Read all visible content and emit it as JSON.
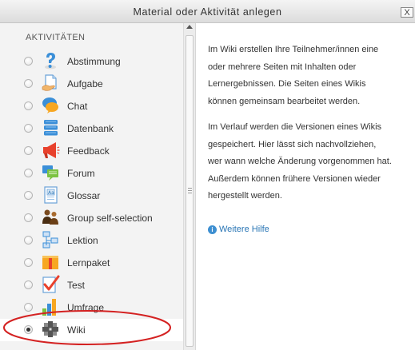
{
  "dialog": {
    "title": "Material oder Aktivität anlegen",
    "close_label": "X"
  },
  "sidebar": {
    "heading": "AKTIVITÄTEN",
    "items": [
      {
        "label": "Abstimmung",
        "icon": "question-icon",
        "checked": false
      },
      {
        "label": "Aufgabe",
        "icon": "assignment-icon",
        "checked": false
      },
      {
        "label": "Chat",
        "icon": "chat-icon",
        "checked": false
      },
      {
        "label": "Datenbank",
        "icon": "database-icon",
        "checked": false
      },
      {
        "label": "Feedback",
        "icon": "megaphone-icon",
        "checked": false
      },
      {
        "label": "Forum",
        "icon": "forum-icon",
        "checked": false
      },
      {
        "label": "Glossar",
        "icon": "glossary-icon",
        "checked": false
      },
      {
        "label": "Group self-selection",
        "icon": "group-icon",
        "checked": false
      },
      {
        "label": "Lektion",
        "icon": "lesson-icon",
        "checked": false
      },
      {
        "label": "Lernpaket",
        "icon": "package-icon",
        "checked": false
      },
      {
        "label": "Test",
        "icon": "checkmark-icon",
        "checked": false
      },
      {
        "label": "Umfrage",
        "icon": "survey-chart-icon",
        "checked": false
      },
      {
        "label": "Wiki",
        "icon": "wiki-icon",
        "checked": true
      }
    ]
  },
  "help": {
    "paragraph1": [
      "Im Wiki erstellen Ihre Teilnehmer/innen eine",
      "oder mehrere Seiten mit Inhalten oder",
      "Lernergebnissen. Die Seiten eines Wikis",
      "können gemeinsam bearbeitet werden."
    ],
    "paragraph2": [
      "Im Verlauf werden die Versionen eines Wikis",
      "gespeichert. Hier lässt sich nachvollziehen,",
      "wer wann welche Änderung vorgenommen hat.",
      "Außerdem können frühere Versionen wieder",
      "hergestellt werden."
    ],
    "more_link": "Weitere Hilfe"
  },
  "colors": {
    "accent_link": "#2a76b5",
    "highlight_ring": "#d42222"
  }
}
